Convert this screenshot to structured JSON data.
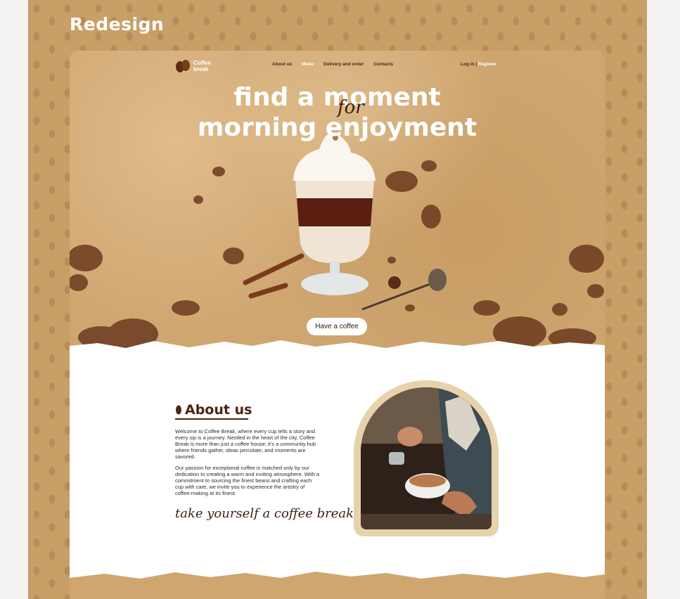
{
  "board": {
    "title": "Redesign"
  },
  "nav": {
    "logo_line1": "Coffee",
    "logo_line2": "break",
    "links": [
      "About us",
      "Menu",
      "Delivery and order",
      "Contacts"
    ],
    "login": "Log in",
    "separator": "|",
    "register": "Register"
  },
  "hero": {
    "line1": "find a moment",
    "for": "for",
    "line2": "morning enjoyment",
    "cta": "Have a coffee"
  },
  "about": {
    "title": "About us",
    "paragraph1": "Welcome to Coffee Break, where every cup tells a story and every sip is a journey. Nestled in the heart of the city, Coffee Break is more than just a coffee house; it's a community hub where friends gather, ideas percolate, and moments are savored.",
    "paragraph2": "Our passion for exceptional coffee is matched only by our dedication to creating a warm and inviting atmosphere. With a commitment to sourcing the finest beans and crafting each cup with care, we invite you to experience the artistry of coffee-making at its finest.",
    "tagline": "take yourself a coffee break."
  },
  "colors": {
    "board": "#c79f67",
    "hero": "#cfa670",
    "accent": "#4a2416",
    "frame": "#e7d2ac"
  },
  "icons": [
    "coffee-bean-icon"
  ]
}
